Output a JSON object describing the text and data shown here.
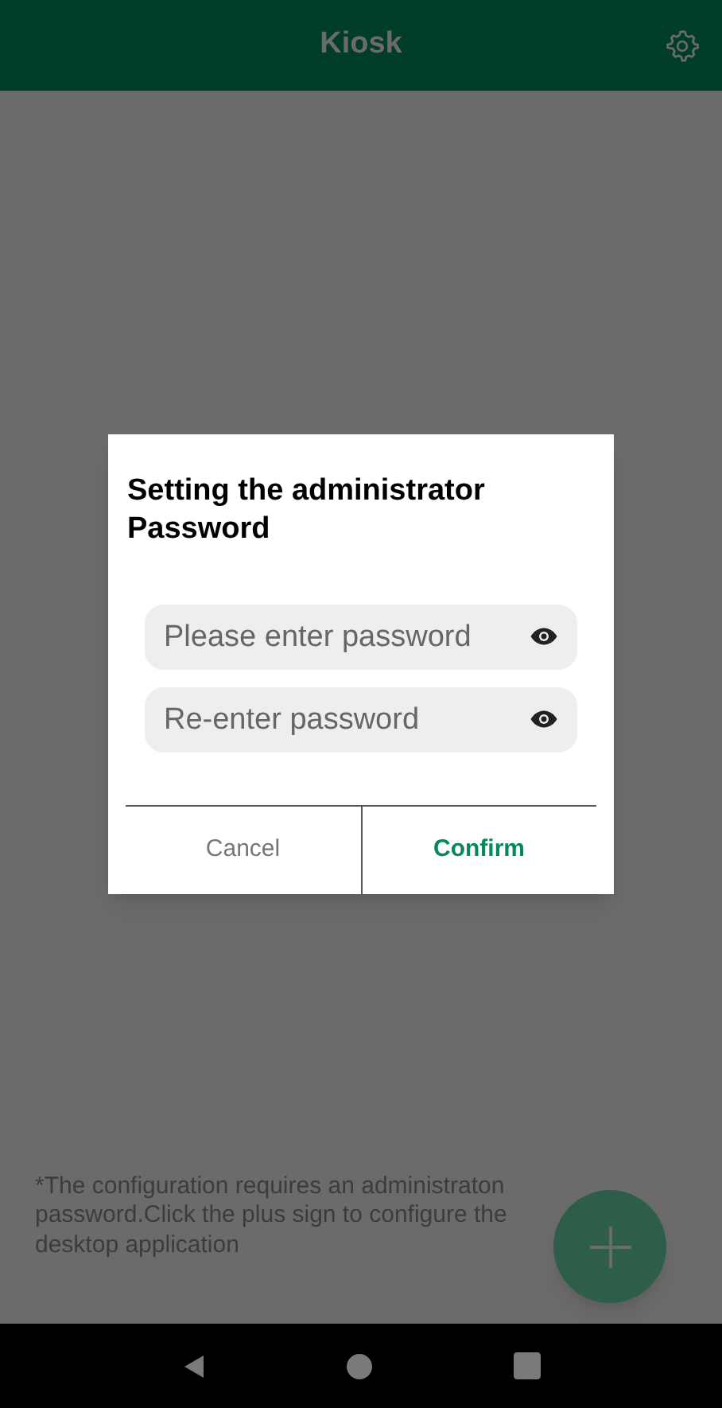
{
  "app_bar": {
    "title": "Kiosk"
  },
  "hint": "*The configuration requires an administraton password.Click the plus sign to configure the desktop application",
  "dialog": {
    "title": "Setting the administrator Password",
    "fields": [
      {
        "placeholder": "Please enter password"
      },
      {
        "placeholder": "Re-enter password"
      }
    ],
    "buttons": [
      {
        "label": "Cancel",
        "kind": "secondary"
      },
      {
        "label": "Confirm",
        "kind": "primary"
      }
    ]
  }
}
